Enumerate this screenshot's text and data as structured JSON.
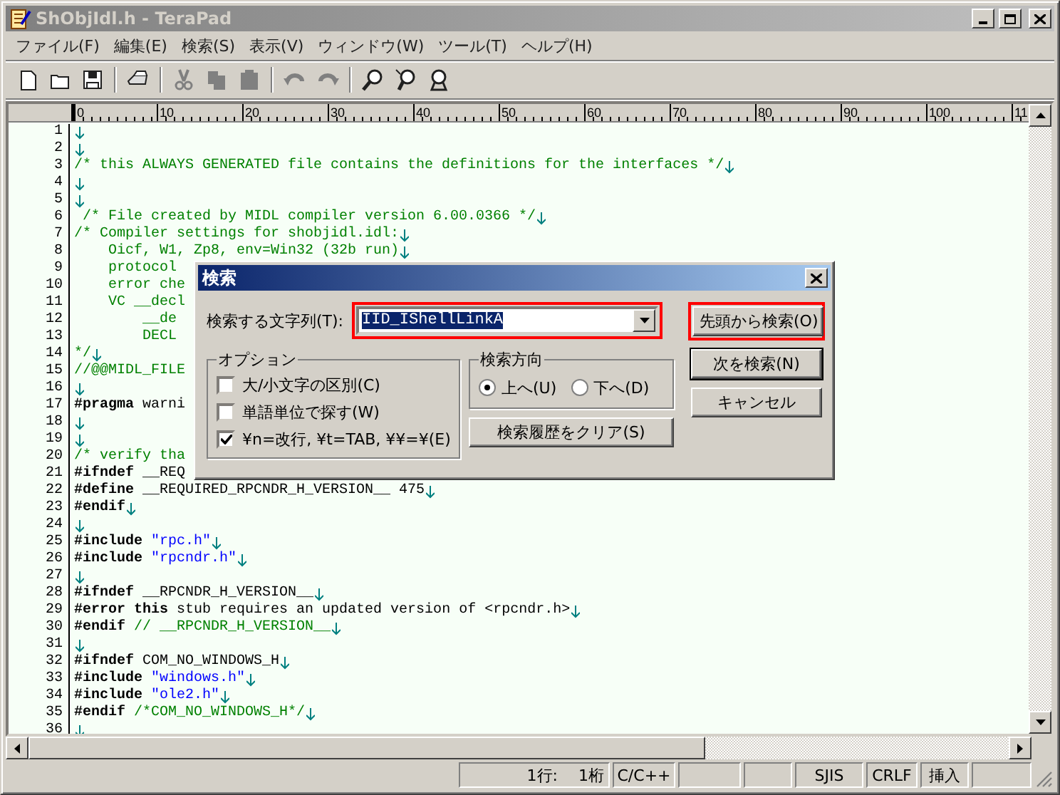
{
  "window": {
    "title": "ShObjIdl.h - TeraPad",
    "active": false
  },
  "menu": [
    "ファイル(F)",
    "編集(E)",
    "検索(S)",
    "表示(V)",
    "ウィンドウ(W)",
    "ツール(T)",
    "ヘルプ(H)"
  ],
  "toolbar": [
    {
      "kind": "new",
      "disabled": false,
      "separator_before": false
    },
    {
      "kind": "open",
      "disabled": false,
      "separator_before": false
    },
    {
      "kind": "save",
      "disabled": false,
      "separator_before": false
    },
    {
      "kind": "print",
      "disabled": false,
      "separator_before": true
    },
    {
      "kind": "cut",
      "disabled": true,
      "separator_before": true
    },
    {
      "kind": "copy",
      "disabled": true,
      "separator_before": false
    },
    {
      "kind": "paste",
      "disabled": true,
      "separator_before": false
    },
    {
      "kind": "undo",
      "disabled": true,
      "separator_before": true
    },
    {
      "kind": "redo",
      "disabled": true,
      "separator_before": false
    },
    {
      "kind": "find",
      "disabled": false,
      "separator_before": true
    },
    {
      "kind": "find_next",
      "disabled": false,
      "separator_before": false
    },
    {
      "kind": "find_prev",
      "disabled": false,
      "separator_before": false
    }
  ],
  "ruler": [
    "0",
    "10",
    "20",
    "30",
    "40",
    "50",
    "60",
    "70",
    "80",
    "90",
    "100",
    "11"
  ],
  "editor": {
    "lines": [
      {
        "num": "1",
        "eol": true
      },
      {
        "num": "2",
        "eol": true
      },
      {
        "num": "3",
        "eol": true,
        "segments": [
          {
            "kind": "comment",
            "text": "/* this ALWAYS GENERATED file contains the definitions for the interfaces */"
          }
        ]
      },
      {
        "num": "4",
        "eol": true
      },
      {
        "num": "5",
        "eol": true
      },
      {
        "num": "6",
        "eol": true,
        "segments": [
          {
            "kind": "comment",
            "text": " /* File created by MIDL compiler version 6.00.0366 */"
          }
        ]
      },
      {
        "num": "7",
        "eol": true,
        "segments": [
          {
            "kind": "comment",
            "text": "/* Compiler settings for shobjidl.idl:"
          }
        ]
      },
      {
        "num": "8",
        "eol": true,
        "segments": [
          {
            "kind": "comment",
            "text": "    Oicf, W1, Zp8, env=Win32 (32b run)"
          }
        ]
      },
      {
        "num": "9",
        "eol": false,
        "segments": [
          {
            "kind": "comment",
            "text": "    protocol"
          }
        ]
      },
      {
        "num": "10",
        "eol": false,
        "segments": [
          {
            "kind": "comment",
            "text": "    error che"
          }
        ]
      },
      {
        "num": "11",
        "eol": false,
        "segments": [
          {
            "kind": "comment",
            "text": "    VC __decl"
          }
        ]
      },
      {
        "num": "12",
        "eol": false,
        "segments": [
          {
            "kind": "comment",
            "text": "        __de"
          }
        ]
      },
      {
        "num": "13",
        "eol": false,
        "segments": [
          {
            "kind": "comment",
            "text": "        DECL"
          }
        ]
      },
      {
        "num": "14",
        "eol": true,
        "segments": [
          {
            "kind": "comment",
            "text": "*/"
          }
        ]
      },
      {
        "num": "15",
        "eol": false,
        "segments": [
          {
            "kind": "comment",
            "text": "//@@MIDL_FILE"
          }
        ]
      },
      {
        "num": "16",
        "eol": true
      },
      {
        "num": "17",
        "eol": false,
        "segments": [
          {
            "kind": "keyword",
            "text": "#pragma"
          },
          {
            "kind": "plain",
            "text": " warni"
          }
        ]
      },
      {
        "num": "18",
        "eol": true
      },
      {
        "num": "19",
        "eol": true
      },
      {
        "num": "20",
        "eol": false,
        "segments": [
          {
            "kind": "comment",
            "text": "/* verify tha"
          }
        ]
      },
      {
        "num": "21",
        "eol": false,
        "segments": [
          {
            "kind": "keyword",
            "text": "#ifndef"
          },
          {
            "kind": "plain",
            "text": " __REQ"
          }
        ]
      },
      {
        "num": "22",
        "eol": true,
        "segments": [
          {
            "kind": "keyword",
            "text": "#define"
          },
          {
            "kind": "plain",
            "text": " __REQUIRED_RPCNDR_H_VERSION__ 475"
          }
        ]
      },
      {
        "num": "23",
        "eol": true,
        "segments": [
          {
            "kind": "keyword",
            "text": "#endif"
          }
        ]
      },
      {
        "num": "24",
        "eol": true
      },
      {
        "num": "25",
        "eol": true,
        "segments": [
          {
            "kind": "keyword",
            "text": "#include"
          },
          {
            "kind": "string",
            "text": " \"rpc.h\""
          }
        ]
      },
      {
        "num": "26",
        "eol": true,
        "segments": [
          {
            "kind": "keyword",
            "text": "#include"
          },
          {
            "kind": "string",
            "text": " \"rpcndr.h\""
          }
        ]
      },
      {
        "num": "27",
        "eol": true
      },
      {
        "num": "28",
        "eol": true,
        "segments": [
          {
            "kind": "keyword",
            "text": "#ifndef"
          },
          {
            "kind": "plain",
            "text": " __RPCNDR_H_VERSION__"
          }
        ]
      },
      {
        "num": "29",
        "eol": true,
        "segments": [
          {
            "kind": "keyword",
            "text": "#error"
          },
          {
            "kind": "keyword",
            "text": " this"
          },
          {
            "kind": "plain",
            "text": " stub requires an updated version of <rpcndr.h>"
          }
        ]
      },
      {
        "num": "30",
        "eol": true,
        "segments": [
          {
            "kind": "keyword",
            "text": "#endif"
          },
          {
            "kind": "comment",
            "text": " // __RPCNDR_H_VERSION__"
          }
        ]
      },
      {
        "num": "31",
        "eol": true
      },
      {
        "num": "32",
        "eol": true,
        "segments": [
          {
            "kind": "keyword",
            "text": "#ifndef"
          },
          {
            "kind": "plain",
            "text": " COM_NO_WINDOWS_H"
          }
        ]
      },
      {
        "num": "33",
        "eol": true,
        "segments": [
          {
            "kind": "keyword",
            "text": "#include"
          },
          {
            "kind": "string",
            "text": " \"windows.h\""
          }
        ]
      },
      {
        "num": "34",
        "eol": true,
        "segments": [
          {
            "kind": "keyword",
            "text": "#include"
          },
          {
            "kind": "string",
            "text": " \"ole2.h\""
          }
        ]
      },
      {
        "num": "35",
        "eol": true,
        "segments": [
          {
            "kind": "keyword",
            "text": "#endif"
          },
          {
            "kind": "comment",
            "text": " /*COM_NO_WINDOWS_H*/"
          }
        ]
      },
      {
        "num": "36",
        "eol": true
      }
    ]
  },
  "dialog": {
    "title": "検索",
    "search_label": "検索する文字列(T):",
    "search_field": {
      "value": "IID_IShellLinkA",
      "highlighted": true
    },
    "buttons": [
      {
        "label": "先頭から検索(O)",
        "highlighted": true,
        "default": false
      },
      {
        "label": "次を検索(N)",
        "highlighted": false,
        "default": true
      },
      {
        "label": "キャンセル",
        "highlighted": false,
        "default": false
      }
    ],
    "options_title": "オプション",
    "options": [
      {
        "label": "大/小文字の区別(C)",
        "checked": false
      },
      {
        "label": "単語単位で探す(W)",
        "checked": false
      },
      {
        "label": "¥n=改行, ¥t=TAB, ¥¥=¥(E)",
        "checked": true
      }
    ],
    "direction_title": "検索方向",
    "direction": [
      {
        "label": "上へ(U)",
        "selected": true
      },
      {
        "label": "下へ(D)",
        "selected": false
      }
    ],
    "clear_button": "検索履歴をクリア(S)"
  },
  "status_bar": [
    {
      "kind": "text",
      "text": "1行:　 1桁"
    },
    {
      "kind": "text",
      "text": "C/C++"
    },
    {
      "kind": "empty"
    },
    {
      "kind": "empty"
    },
    {
      "kind": "text",
      "text": "SJIS"
    },
    {
      "kind": "text",
      "text": "CRLF"
    },
    {
      "kind": "text",
      "text": "挿入"
    },
    {
      "kind": "empty"
    }
  ]
}
